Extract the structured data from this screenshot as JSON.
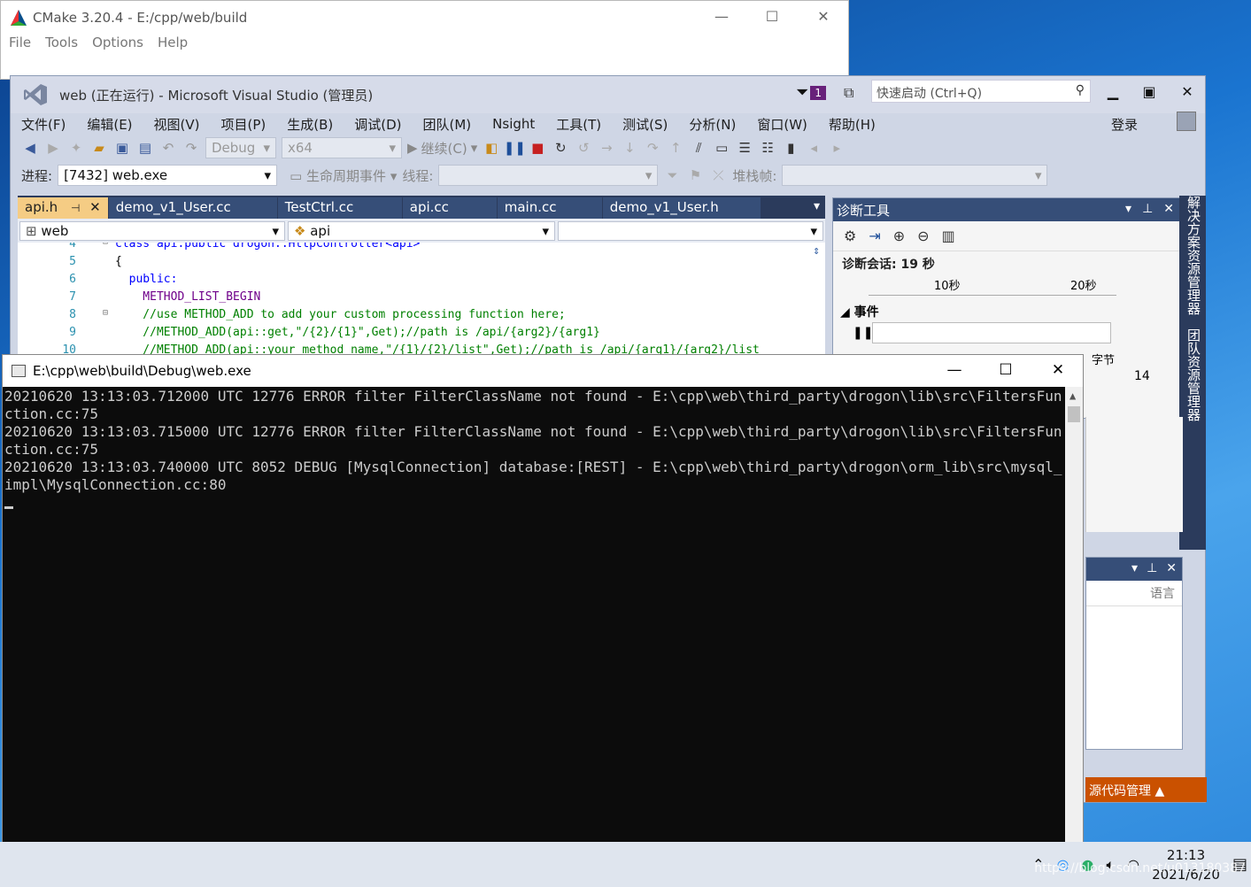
{
  "cmake": {
    "title": "CMake 3.20.4 - E:/cpp/web/build",
    "menu": [
      "File",
      "Tools",
      "Options",
      "Help"
    ]
  },
  "vs": {
    "title": "web (正在运行) - Microsoft Visual Studio (管理员)",
    "notification_count": "1",
    "quick_launch_placeholder": "快速启动 (Ctrl+Q)",
    "menu": [
      "文件(F)",
      "编辑(E)",
      "视图(V)",
      "项目(P)",
      "生成(B)",
      "调试(D)",
      "团队(M)",
      "Nsight",
      "工具(T)",
      "测试(S)",
      "分析(N)",
      "窗口(W)",
      "帮助(H)"
    ],
    "login": "登录",
    "toolbar": {
      "config": "Debug",
      "platform": "x64",
      "continue": "继续(C)"
    },
    "debugbar": {
      "process_label": "进程:",
      "process_value": "[7432] web.exe",
      "lifecycle": "生命周期事件",
      "thread_label": "线程:",
      "stack_label": "堆栈帧:"
    },
    "tabs": [
      "api.h",
      "demo_v1_User.cc",
      "TestCtrl.cc",
      "api.cc",
      "main.cc",
      "demo_v1_User.h"
    ],
    "nav": {
      "project": "web",
      "scope": "api"
    },
    "code_lines": [
      {
        "num": "4",
        "text": "class api:public drogon::HttpController<api>"
      },
      {
        "num": "5",
        "text": "{"
      },
      {
        "num": "6",
        "text": "  public:"
      },
      {
        "num": "7",
        "text": "    METHOD_LIST_BEGIN"
      },
      {
        "num": "8",
        "text": "    //use METHOD_ADD to add your custom processing function here;"
      },
      {
        "num": "9",
        "text": "    //METHOD_ADD(api::get,\"/{2}/{1}\",Get);//path is /api/{arg2}/{arg1}"
      },
      {
        "num": "10",
        "text": "    //METHOD_ADD(api::your_method_name,\"/{1}/{2}/list\",Get);//path is /api/{arg1}/{arg2}/list"
      }
    ],
    "diag": {
      "title": "诊断工具",
      "session": "诊断会话: 19 秒",
      "tick1": "10秒",
      "tick2": "20秒",
      "events": "事件",
      "value": "14",
      "bytes": "字节"
    },
    "side_tabs": [
      "解决方案资源管理器",
      "团队资源管理器"
    ],
    "lang_label": "语言",
    "status": "源代码管理 ▲"
  },
  "console": {
    "title": "E:\\cpp\\web\\build\\Debug\\web.exe",
    "lines": [
      "20210620 13:13:03.712000 UTC 12776 ERROR filter FilterClassName not found - E:\\cpp\\web\\third_party\\drogon\\lib\\src\\FiltersFunction.cc:75",
      "20210620 13:13:03.715000 UTC 12776 ERROR filter FilterClassName not found - E:\\cpp\\web\\third_party\\drogon\\lib\\src\\FiltersFunction.cc:75",
      "20210620 13:13:03.740000 UTC 8052 DEBUG [MysqlConnection] database:[REST] - E:\\cpp\\web\\third_party\\drogon\\orm_lib\\src\\mysql_impl\\MysqlConnection.cc:80"
    ]
  },
  "taskbar": {
    "time": "21:13",
    "date": "2021/6/20",
    "watermark": "https://blog.csdn.net/u013180387"
  }
}
